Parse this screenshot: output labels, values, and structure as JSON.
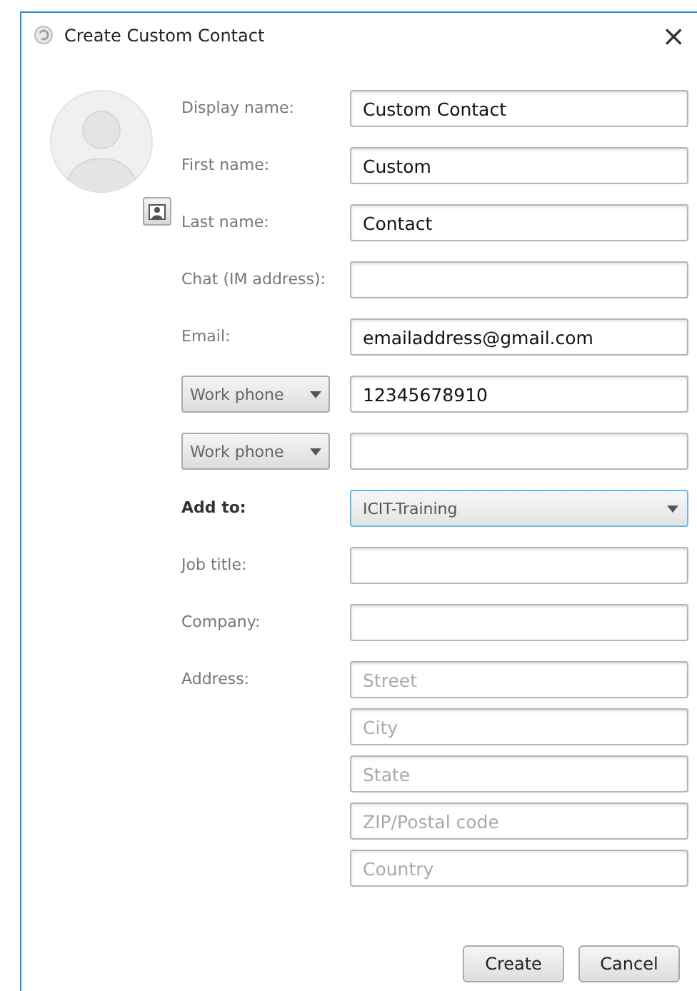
{
  "window": {
    "title": "Create Custom Contact",
    "close": "×"
  },
  "rows": [
    {
      "kind": "text",
      "label": "Display name:",
      "value": "Custom Contact"
    },
    {
      "kind": "text",
      "label": "First name:",
      "value": "Custom"
    },
    {
      "kind": "text",
      "label": "Last name:",
      "value": "Contact"
    },
    {
      "kind": "text",
      "label": "Chat (IM address):"
    },
    {
      "kind": "text",
      "label": "Email:",
      "value": "emailaddress@gmail.com"
    },
    {
      "kind": "phone",
      "type": "Work phone",
      "value": "12345678910"
    },
    {
      "kind": "phone",
      "type": "Work phone"
    },
    {
      "kind": "select",
      "label": "Add to:",
      "value": "ICIT-Training"
    },
    {
      "kind": "text",
      "label": "Job title:"
    },
    {
      "kind": "text",
      "label": "Company:"
    },
    {
      "kind": "address",
      "label": "Address:",
      "placeholders": [
        "Street",
        "City",
        "State",
        "ZIP/Postal code",
        "Country"
      ]
    }
  ],
  "buttons": [
    "Create",
    "Cancel"
  ]
}
